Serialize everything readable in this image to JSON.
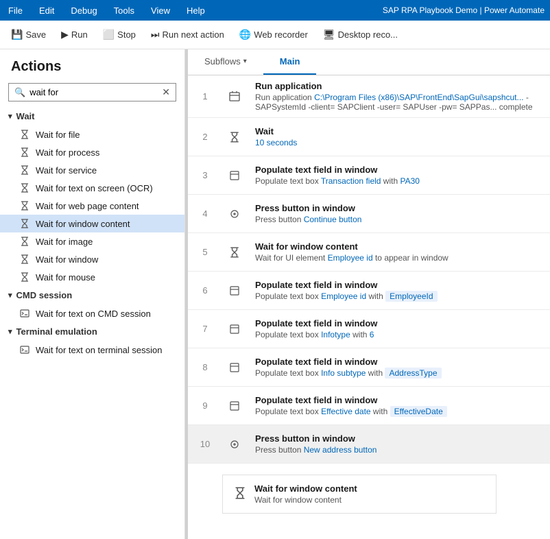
{
  "titleBar": {
    "appTitle": "SAP RPA Playbook Demo | Power Automate",
    "menuItems": [
      "File",
      "Edit",
      "Debug",
      "Tools",
      "View",
      "Help"
    ]
  },
  "toolbar": {
    "buttons": [
      {
        "label": "Save",
        "icon": "💾"
      },
      {
        "label": "Run",
        "icon": "▶"
      },
      {
        "label": "Stop",
        "icon": "⬜"
      },
      {
        "label": "Run next action",
        "icon": "⏭"
      },
      {
        "label": "Web recorder",
        "icon": "🌐"
      },
      {
        "label": "Desktop reco...",
        "icon": "🖥"
      }
    ]
  },
  "sidebar": {
    "title": "Actions",
    "searchPlaceholder": "wait for",
    "searchValue": "wait for",
    "categories": [
      {
        "name": "Wait",
        "items": [
          "Wait for file",
          "Wait for process",
          "Wait for service",
          "Wait for text on screen (OCR)",
          "Wait for web page content",
          "Wait for window content",
          "Wait for image",
          "Wait for window",
          "Wait for mouse"
        ]
      },
      {
        "name": "CMD session",
        "items": [
          "Wait for text on CMD session"
        ]
      },
      {
        "name": "Terminal emulation",
        "items": [
          "Wait for text on terminal session"
        ]
      }
    ]
  },
  "tabs": [
    {
      "label": "Subflows",
      "active": false,
      "dropdown": true
    },
    {
      "label": "Main",
      "active": true
    }
  ],
  "steps": [
    {
      "number": 1,
      "iconType": "app",
      "title": "Run application",
      "desc": "Run application C:\\Program Files (x86)\\SAP\\FrontEnd\\SapGui\\sapshcut... -SAPSystemId -client= SAPClient -user= SAPUser -pw= SAPPas... complete",
      "descParts": [
        {
          "text": "Run application "
        },
        {
          "text": "C:\\Program Files (x86)\\SAP\\FrontEnd\\SapGui\\sapshcut...",
          "type": "link"
        },
        {
          "text": " -SAPSystemId -client= SAPClient -user= SAPUser -pw= SAPPas... complete"
        }
      ]
    },
    {
      "number": 2,
      "iconType": "hourglass",
      "title": "Wait",
      "desc": "10 seconds",
      "descParts": [
        {
          "text": "10 seconds",
          "type": "link"
        }
      ]
    },
    {
      "number": 3,
      "iconType": "window",
      "title": "Populate text field in window",
      "desc": "Populate text box Transaction field with PA30",
      "descParts": [
        {
          "text": "Populate text box "
        },
        {
          "text": "Transaction field",
          "type": "link"
        },
        {
          "text": " with "
        },
        {
          "text": "PA30",
          "type": "link"
        }
      ]
    },
    {
      "number": 4,
      "iconType": "cursor",
      "title": "Press button in window",
      "desc": "Press button Continue button",
      "descParts": [
        {
          "text": "Press button "
        },
        {
          "text": "Continue button",
          "type": "link"
        }
      ]
    },
    {
      "number": 5,
      "iconType": "hourglass",
      "title": "Wait for window content",
      "desc": "Wait for UI element Employee id to appear in window",
      "descParts": [
        {
          "text": "Wait for UI element "
        },
        {
          "text": "Employee id",
          "type": "link"
        },
        {
          "text": " to appear in window"
        }
      ]
    },
    {
      "number": 6,
      "iconType": "window",
      "title": "Populate text field in window",
      "desc": "Populate text box Employee id with EmployeeId",
      "descParts": [
        {
          "text": "Populate text box "
        },
        {
          "text": "Employee id",
          "type": "link"
        },
        {
          "text": " with "
        },
        {
          "text": "EmployeeId",
          "type": "badge"
        }
      ]
    },
    {
      "number": 7,
      "iconType": "window",
      "title": "Populate text field in window",
      "desc": "Populate text box Infotype with 6",
      "descParts": [
        {
          "text": "Populate text box "
        },
        {
          "text": "Infotype",
          "type": "link"
        },
        {
          "text": " with "
        },
        {
          "text": "6",
          "type": "link"
        }
      ]
    },
    {
      "number": 8,
      "iconType": "window",
      "title": "Populate text field in window",
      "desc": "Populate text box Info subtype with AddressType",
      "descParts": [
        {
          "text": "Populate text box "
        },
        {
          "text": "Info subtype",
          "type": "link"
        },
        {
          "text": " with "
        },
        {
          "text": "AddressType",
          "type": "badge"
        }
      ]
    },
    {
      "number": 9,
      "iconType": "window",
      "title": "Populate text field in window",
      "desc": "Populate text box Effective date with EffectiveDate",
      "descParts": [
        {
          "text": "Populate text box "
        },
        {
          "text": "Effective date",
          "type": "link"
        },
        {
          "text": " with "
        },
        {
          "text": "EffectiveDate",
          "type": "badge"
        }
      ]
    },
    {
      "number": 10,
      "iconType": "cursor",
      "title": "Press button in window",
      "desc": "Press button New address button",
      "highlighted": true,
      "descParts": [
        {
          "text": "Press button "
        },
        {
          "text": "New address button",
          "type": "link"
        }
      ]
    }
  ],
  "miniCard": {
    "title": "Wait for window content",
    "desc": "Wait for window content"
  }
}
